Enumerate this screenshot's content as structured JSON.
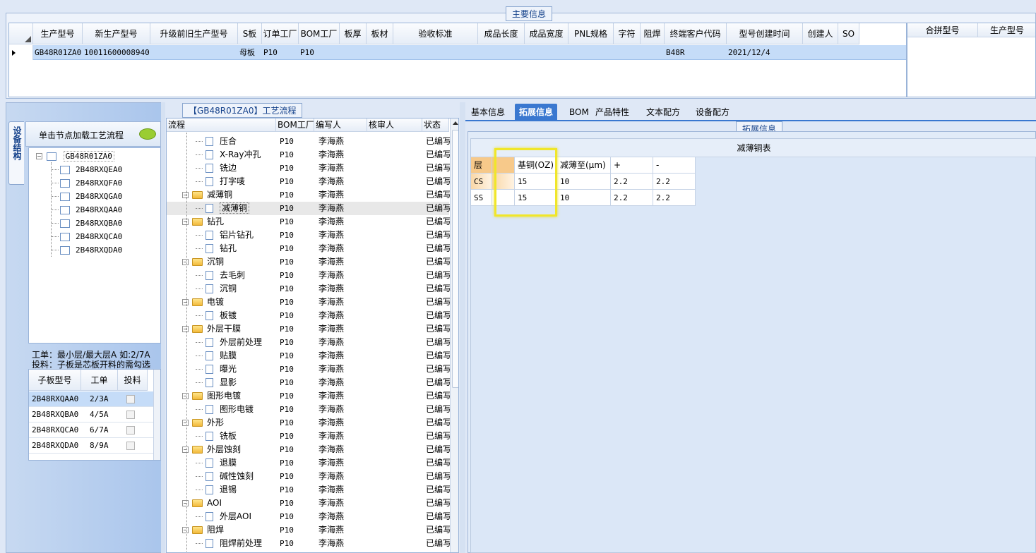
{
  "main_info": {
    "title": "主要信息",
    "columns": [
      "生产型号",
      "新生产型号",
      "升级前旧生产型号",
      "S板",
      "订单工厂",
      "BOM工厂",
      "板厚",
      "板材",
      "验收标准",
      "成品长度",
      "成品宽度",
      "PNL规格",
      "字符",
      "阻焊",
      "终端客户代码",
      "型号创建时间",
      "创建人",
      "SO"
    ],
    "row": {
      "生产型号": "GB48R01ZA0",
      "新生产型号": "10011600008940",
      "S板": "母板",
      "订单工厂": "P10",
      "BOM工厂": "P10",
      "终端客户代码": "B48R",
      "型号创建时间": "2021/12/4"
    },
    "side_columns": [
      "合拼型号",
      "生产型号"
    ]
  },
  "left_panel": {
    "vertical_tab": "设备结构",
    "header": "单击节点加载工艺流程",
    "tree_root": "GB48R01ZA0",
    "tree_children": [
      "2B48RXQEA0",
      "2B48RXQFA0",
      "2B48RXQGA0",
      "2B48RXQAA0",
      "2B48RXQBA0",
      "2B48RXQCA0",
      "2B48RXQDA0"
    ],
    "note_line1": "工单：最小层/最大层A 如:2/7A",
    "note_line2": "投料：子板是芯板开料的需勾选",
    "sub_columns": [
      "子板型号",
      "工单",
      "投料"
    ],
    "sub_rows": [
      {
        "code": "2B48RXQAA0",
        "order": "2/3A"
      },
      {
        "code": "2B48RXQBA0",
        "order": "4/5A"
      },
      {
        "code": "2B48RXQCA0",
        "order": "6/7A"
      },
      {
        "code": "2B48RXQDA0",
        "order": "8/9A"
      }
    ]
  },
  "process": {
    "title": "【GB48R01ZA0】工艺流程",
    "columns": [
      "流程",
      "BOM工厂",
      "编写人",
      "核审人",
      "状态"
    ],
    "factory": "P10",
    "author": "李海燕",
    "status": "已编写",
    "rows": [
      {
        "name": "压合",
        "level": 2
      },
      {
        "name": "X-Ray冲孔",
        "level": 2
      },
      {
        "name": "铣边",
        "level": 2
      },
      {
        "name": "打字唛",
        "level": 2
      },
      {
        "name": "减薄铜",
        "level": 1
      },
      {
        "name": "减薄铜",
        "level": 2
      },
      {
        "name": "钻孔",
        "level": 1
      },
      {
        "name": "铝片钻孔",
        "level": 2
      },
      {
        "name": "钻孔",
        "level": 2
      },
      {
        "name": "沉铜",
        "level": 1
      },
      {
        "name": "去毛刺",
        "level": 2
      },
      {
        "name": "沉铜",
        "level": 2
      },
      {
        "name": "电镀",
        "level": 1
      },
      {
        "name": "板镀",
        "level": 2
      },
      {
        "name": "外层干膜",
        "level": 1
      },
      {
        "name": "外层前处理",
        "level": 2
      },
      {
        "name": "贴膜",
        "level": 2
      },
      {
        "name": "曝光",
        "level": 2
      },
      {
        "name": "显影",
        "level": 2
      },
      {
        "name": "图形电镀",
        "level": 1
      },
      {
        "name": "图形电镀",
        "level": 2
      },
      {
        "name": "外形",
        "level": 1
      },
      {
        "name": "铣板",
        "level": 2
      },
      {
        "name": "外层蚀刻",
        "level": 1
      },
      {
        "name": "退膜",
        "level": 2
      },
      {
        "name": "碱性蚀刻",
        "level": 2
      },
      {
        "name": "退锡",
        "level": 2
      },
      {
        "name": "AOI",
        "level": 1
      },
      {
        "name": "外层AOI",
        "level": 2
      },
      {
        "name": "阻焊",
        "level": 1
      },
      {
        "name": "阻焊前处理",
        "level": 2
      }
    ]
  },
  "tabs": [
    "基本信息",
    "拓展信息",
    "BOM",
    "产品特性",
    "文本配方",
    "设备配方"
  ],
  "active_tab": "拓展信息",
  "ext": {
    "title": "拓展信息",
    "table_title": "减薄铜表",
    "columns": [
      "层",
      "",
      "基铜(OZ)",
      "减薄至(μm)",
      "+",
      "-"
    ],
    "rows": [
      {
        "layer": "CS",
        "base": "15",
        "thin": "10",
        "plus": "2.2",
        "minus": "2.2"
      },
      {
        "layer": "SS",
        "base": "15",
        "thin": "10",
        "plus": "2.2",
        "minus": "2.2"
      }
    ]
  },
  "colors": {
    "accent": "#3a78d0",
    "highlight": "#f0e62a",
    "row_select": "#c5dcf8"
  }
}
